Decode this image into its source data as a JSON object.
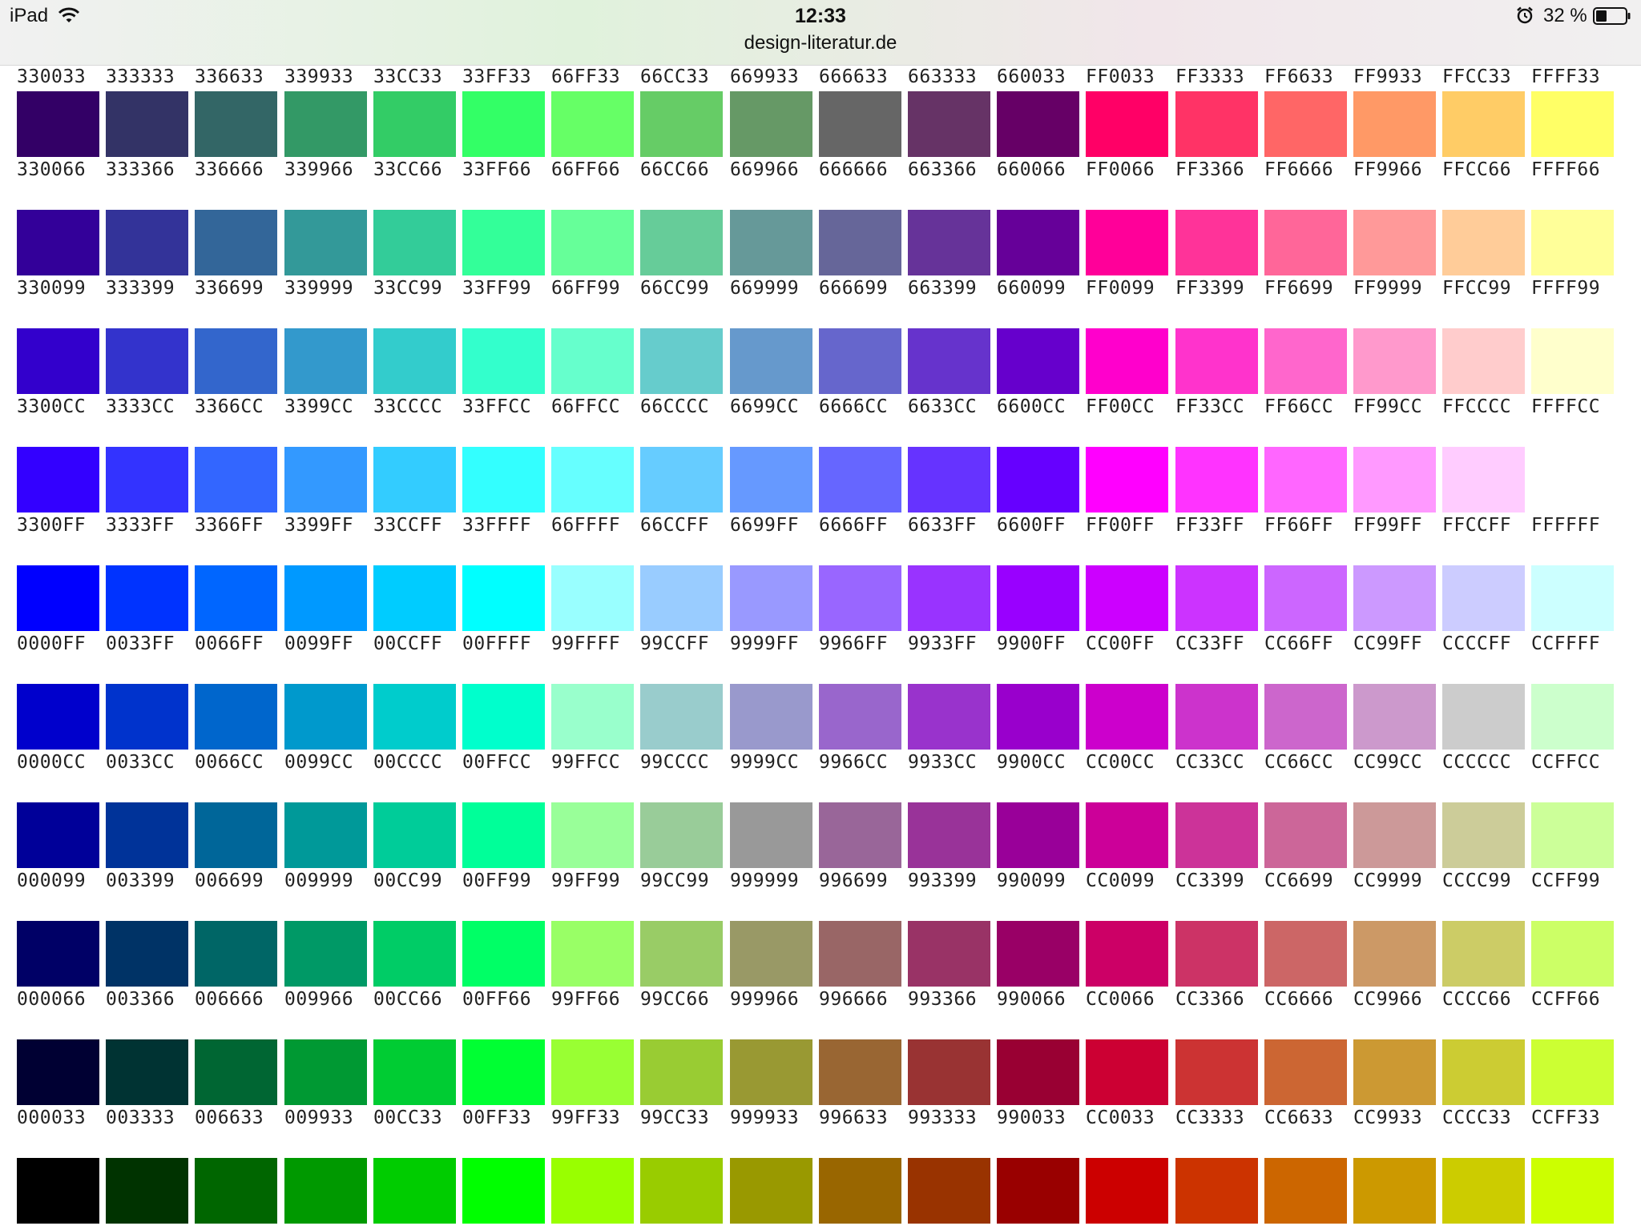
{
  "status_bar": {
    "device": "iPad",
    "time": "12:33",
    "url": "design-literatur.de",
    "battery_percent": "32 %"
  },
  "palette": {
    "rows": [
      [
        "330033",
        "333333",
        "336633",
        "339933",
        "33CC33",
        "33FF33",
        "66FF33",
        "66CC33",
        "669933",
        "666633",
        "663333",
        "660033",
        "FF0033",
        "FF3333",
        "FF6633",
        "FF9933",
        "FFCC33",
        "FFFF33"
      ],
      [
        "330066",
        "333366",
        "336666",
        "339966",
        "33CC66",
        "33FF66",
        "66FF66",
        "66CC66",
        "669966",
        "666666",
        "663366",
        "660066",
        "FF0066",
        "FF3366",
        "FF6666",
        "FF9966",
        "FFCC66",
        "FFFF66"
      ],
      [
        "330099",
        "333399",
        "336699",
        "339999",
        "33CC99",
        "33FF99",
        "66FF99",
        "66CC99",
        "669999",
        "666699",
        "663399",
        "660099",
        "FF0099",
        "FF3399",
        "FF6699",
        "FF9999",
        "FFCC99",
        "FFFF99"
      ],
      [
        "3300CC",
        "3333CC",
        "3366CC",
        "3399CC",
        "33CCCC",
        "33FFCC",
        "66FFCC",
        "66CCCC",
        "6699CC",
        "6666CC",
        "6633CC",
        "6600CC",
        "FF00CC",
        "FF33CC",
        "FF66CC",
        "FF99CC",
        "FFCCCC",
        "FFFFCC"
      ],
      [
        "3300FF",
        "3333FF",
        "3366FF",
        "3399FF",
        "33CCFF",
        "33FFFF",
        "66FFFF",
        "66CCFF",
        "6699FF",
        "6666FF",
        "6633FF",
        "6600FF",
        "FF00FF",
        "FF33FF",
        "FF66FF",
        "FF99FF",
        "FFCCFF",
        "FFFFFF"
      ],
      [
        "0000FF",
        "0033FF",
        "0066FF",
        "0099FF",
        "00CCFF",
        "00FFFF",
        "99FFFF",
        "99CCFF",
        "9999FF",
        "9966FF",
        "9933FF",
        "9900FF",
        "CC00FF",
        "CC33FF",
        "CC66FF",
        "CC99FF",
        "CCCCFF",
        "CCFFFF"
      ],
      [
        "0000CC",
        "0033CC",
        "0066CC",
        "0099CC",
        "00CCCC",
        "00FFCC",
        "99FFCC",
        "99CCCC",
        "9999CC",
        "9966CC",
        "9933CC",
        "9900CC",
        "CC00CC",
        "CC33CC",
        "CC66CC",
        "CC99CC",
        "CCCCCC",
        "CCFFCC"
      ],
      [
        "000099",
        "003399",
        "006699",
        "009999",
        "00CC99",
        "00FF99",
        "99FF99",
        "99CC99",
        "999999",
        "996699",
        "993399",
        "990099",
        "CC0099",
        "CC3399",
        "CC6699",
        "CC9999",
        "CCCC99",
        "CCFF99"
      ],
      [
        "000066",
        "003366",
        "006666",
        "009966",
        "00CC66",
        "00FF66",
        "99FF66",
        "99CC66",
        "999966",
        "996666",
        "993366",
        "990066",
        "CC0066",
        "CC3366",
        "CC6666",
        "CC9966",
        "CCCC66",
        "CCFF66"
      ],
      [
        "000033",
        "003333",
        "006633",
        "009933",
        "00CC33",
        "00FF33",
        "99FF33",
        "99CC33",
        "999933",
        "996633",
        "993333",
        "990033",
        "CC0033",
        "CC3333",
        "CC6633",
        "CC9933",
        "CCCC33",
        "CCFF33"
      ],
      [
        "000000",
        "003300",
        "006600",
        "009900",
        "00CC00",
        "00FF00",
        "99FF00",
        "99CC00",
        "999900",
        "996600",
        "993300",
        "990000",
        "CC0000",
        "CC3300",
        "CC6600",
        "CC9900",
        "CCCC00",
        "CCFF00"
      ]
    ],
    "labeled_rows": [
      true,
      true,
      true,
      true,
      true,
      true,
      true,
      true,
      true,
      true,
      false
    ],
    "first_row_swatch_visible": false
  },
  "colors": {
    "status_bar_text": "#111111",
    "label_text": "#222222",
    "page_background": "#FFFFFF"
  },
  "icons": {
    "wifi": "wifi-icon",
    "alarm": "alarm-icon",
    "battery": "battery-icon"
  }
}
